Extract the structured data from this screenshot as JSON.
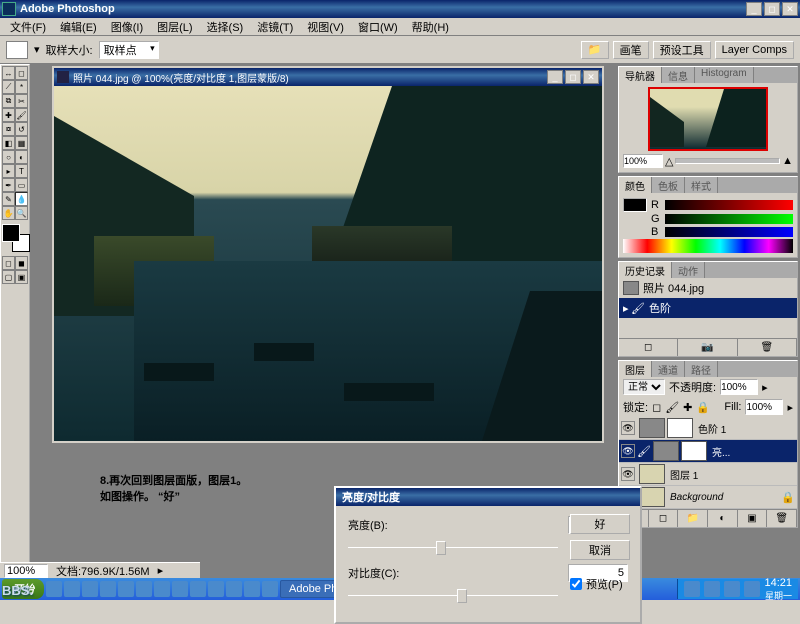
{
  "title": "Adobe Photoshop",
  "menus": [
    "文件(F)",
    "编辑(E)",
    "图像(I)",
    "图层(L)",
    "选择(S)",
    "滤镜(T)",
    "视图(V)",
    "窗口(W)",
    "帮助(H)"
  ],
  "optbar": {
    "label": "取样大小:",
    "value": "取样点",
    "rbtns": [
      "画笔",
      "预设工具",
      "Layer Comps"
    ]
  },
  "doc": {
    "title": "照片 044.jpg @ 100%(亮度/对比度 1,图层蒙版/8)"
  },
  "tutorial": {
    "line1": "8.再次回到图层面版，图层1。",
    "line2": "如图操作。  “好”"
  },
  "dialog": {
    "title": "亮度/对比度",
    "brightness_label": "亮度(B):",
    "brightness_val": "-15",
    "contrast_label": "对比度(C):",
    "contrast_val": "5",
    "ok": "好",
    "cancel": "取消",
    "preview": "预览(P)"
  },
  "navigator": {
    "tabs": [
      "导航器",
      "信息",
      "Histogram"
    ],
    "zoom": "100%"
  },
  "color": {
    "tabs": [
      "颜色",
      "色板",
      "样式"
    ],
    "channels": [
      "R",
      "G",
      "B"
    ]
  },
  "history": {
    "tabs": [
      "历史记录",
      "动作"
    ],
    "items": [
      {
        "label": "照片 044.jpg",
        "sel": false
      },
      {
        "label": "色阶",
        "sel": true
      }
    ]
  },
  "layers": {
    "tabs": [
      "图层",
      "通道",
      "路径"
    ],
    "blend": "正常",
    "opacity_label": "不透明度:",
    "opacity": "100%",
    "lock_label": "锁定:",
    "fill_label": "Fill:",
    "fill": "100%",
    "items": [
      {
        "name": "色阶 1",
        "sel": false,
        "adj": true
      },
      {
        "name": "亮...",
        "sel": true,
        "adj": true
      },
      {
        "name": "图层 1",
        "sel": false,
        "adj": false
      },
      {
        "name": "Background",
        "sel": false,
        "adj": false,
        "italic": true
      }
    ]
  },
  "status": {
    "zoom": "100%",
    "doc": "文档:796.9K/1.56M"
  },
  "taskbar": {
    "start": "开始",
    "task": "Adobe Photoshop",
    "time": "14:21",
    "day": "星期一"
  },
  "watermark": "BBS."
}
